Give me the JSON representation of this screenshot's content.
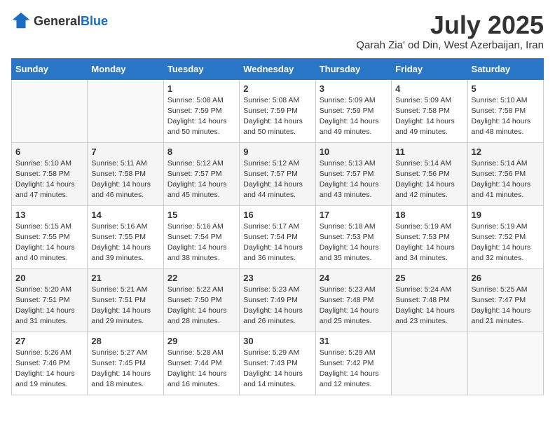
{
  "header": {
    "logo_general": "General",
    "logo_blue": "Blue",
    "month_year": "July 2025",
    "location": "Qarah Zia' od Din, West Azerbaijan, Iran"
  },
  "weekdays": [
    "Sunday",
    "Monday",
    "Tuesday",
    "Wednesday",
    "Thursday",
    "Friday",
    "Saturday"
  ],
  "weeks": [
    [
      {
        "day": "",
        "sunrise": "",
        "sunset": "",
        "daylight": ""
      },
      {
        "day": "",
        "sunrise": "",
        "sunset": "",
        "daylight": ""
      },
      {
        "day": "1",
        "sunrise": "Sunrise: 5:08 AM",
        "sunset": "Sunset: 7:59 PM",
        "daylight": "Daylight: 14 hours and 50 minutes."
      },
      {
        "day": "2",
        "sunrise": "Sunrise: 5:08 AM",
        "sunset": "Sunset: 7:59 PM",
        "daylight": "Daylight: 14 hours and 50 minutes."
      },
      {
        "day": "3",
        "sunrise": "Sunrise: 5:09 AM",
        "sunset": "Sunset: 7:59 PM",
        "daylight": "Daylight: 14 hours and 49 minutes."
      },
      {
        "day": "4",
        "sunrise": "Sunrise: 5:09 AM",
        "sunset": "Sunset: 7:58 PM",
        "daylight": "Daylight: 14 hours and 49 minutes."
      },
      {
        "day": "5",
        "sunrise": "Sunrise: 5:10 AM",
        "sunset": "Sunset: 7:58 PM",
        "daylight": "Daylight: 14 hours and 48 minutes."
      }
    ],
    [
      {
        "day": "6",
        "sunrise": "Sunrise: 5:10 AM",
        "sunset": "Sunset: 7:58 PM",
        "daylight": "Daylight: 14 hours and 47 minutes."
      },
      {
        "day": "7",
        "sunrise": "Sunrise: 5:11 AM",
        "sunset": "Sunset: 7:58 PM",
        "daylight": "Daylight: 14 hours and 46 minutes."
      },
      {
        "day": "8",
        "sunrise": "Sunrise: 5:12 AM",
        "sunset": "Sunset: 7:57 PM",
        "daylight": "Daylight: 14 hours and 45 minutes."
      },
      {
        "day": "9",
        "sunrise": "Sunrise: 5:12 AM",
        "sunset": "Sunset: 7:57 PM",
        "daylight": "Daylight: 14 hours and 44 minutes."
      },
      {
        "day": "10",
        "sunrise": "Sunrise: 5:13 AM",
        "sunset": "Sunset: 7:57 PM",
        "daylight": "Daylight: 14 hours and 43 minutes."
      },
      {
        "day": "11",
        "sunrise": "Sunrise: 5:14 AM",
        "sunset": "Sunset: 7:56 PM",
        "daylight": "Daylight: 14 hours and 42 minutes."
      },
      {
        "day": "12",
        "sunrise": "Sunrise: 5:14 AM",
        "sunset": "Sunset: 7:56 PM",
        "daylight": "Daylight: 14 hours and 41 minutes."
      }
    ],
    [
      {
        "day": "13",
        "sunrise": "Sunrise: 5:15 AM",
        "sunset": "Sunset: 7:55 PM",
        "daylight": "Daylight: 14 hours and 40 minutes."
      },
      {
        "day": "14",
        "sunrise": "Sunrise: 5:16 AM",
        "sunset": "Sunset: 7:55 PM",
        "daylight": "Daylight: 14 hours and 39 minutes."
      },
      {
        "day": "15",
        "sunrise": "Sunrise: 5:16 AM",
        "sunset": "Sunset: 7:54 PM",
        "daylight": "Daylight: 14 hours and 38 minutes."
      },
      {
        "day": "16",
        "sunrise": "Sunrise: 5:17 AM",
        "sunset": "Sunset: 7:54 PM",
        "daylight": "Daylight: 14 hours and 36 minutes."
      },
      {
        "day": "17",
        "sunrise": "Sunrise: 5:18 AM",
        "sunset": "Sunset: 7:53 PM",
        "daylight": "Daylight: 14 hours and 35 minutes."
      },
      {
        "day": "18",
        "sunrise": "Sunrise: 5:19 AM",
        "sunset": "Sunset: 7:53 PM",
        "daylight": "Daylight: 14 hours and 34 minutes."
      },
      {
        "day": "19",
        "sunrise": "Sunrise: 5:19 AM",
        "sunset": "Sunset: 7:52 PM",
        "daylight": "Daylight: 14 hours and 32 minutes."
      }
    ],
    [
      {
        "day": "20",
        "sunrise": "Sunrise: 5:20 AM",
        "sunset": "Sunset: 7:51 PM",
        "daylight": "Daylight: 14 hours and 31 minutes."
      },
      {
        "day": "21",
        "sunrise": "Sunrise: 5:21 AM",
        "sunset": "Sunset: 7:51 PM",
        "daylight": "Daylight: 14 hours and 29 minutes."
      },
      {
        "day": "22",
        "sunrise": "Sunrise: 5:22 AM",
        "sunset": "Sunset: 7:50 PM",
        "daylight": "Daylight: 14 hours and 28 minutes."
      },
      {
        "day": "23",
        "sunrise": "Sunrise: 5:23 AM",
        "sunset": "Sunset: 7:49 PM",
        "daylight": "Daylight: 14 hours and 26 minutes."
      },
      {
        "day": "24",
        "sunrise": "Sunrise: 5:23 AM",
        "sunset": "Sunset: 7:48 PM",
        "daylight": "Daylight: 14 hours and 25 minutes."
      },
      {
        "day": "25",
        "sunrise": "Sunrise: 5:24 AM",
        "sunset": "Sunset: 7:48 PM",
        "daylight": "Daylight: 14 hours and 23 minutes."
      },
      {
        "day": "26",
        "sunrise": "Sunrise: 5:25 AM",
        "sunset": "Sunset: 7:47 PM",
        "daylight": "Daylight: 14 hours and 21 minutes."
      }
    ],
    [
      {
        "day": "27",
        "sunrise": "Sunrise: 5:26 AM",
        "sunset": "Sunset: 7:46 PM",
        "daylight": "Daylight: 14 hours and 19 minutes."
      },
      {
        "day": "28",
        "sunrise": "Sunrise: 5:27 AM",
        "sunset": "Sunset: 7:45 PM",
        "daylight": "Daylight: 14 hours and 18 minutes."
      },
      {
        "day": "29",
        "sunrise": "Sunrise: 5:28 AM",
        "sunset": "Sunset: 7:44 PM",
        "daylight": "Daylight: 14 hours and 16 minutes."
      },
      {
        "day": "30",
        "sunrise": "Sunrise: 5:29 AM",
        "sunset": "Sunset: 7:43 PM",
        "daylight": "Daylight: 14 hours and 14 minutes."
      },
      {
        "day": "31",
        "sunrise": "Sunrise: 5:29 AM",
        "sunset": "Sunset: 7:42 PM",
        "daylight": "Daylight: 14 hours and 12 minutes."
      },
      {
        "day": "",
        "sunrise": "",
        "sunset": "",
        "daylight": ""
      },
      {
        "day": "",
        "sunrise": "",
        "sunset": "",
        "daylight": ""
      }
    ]
  ]
}
